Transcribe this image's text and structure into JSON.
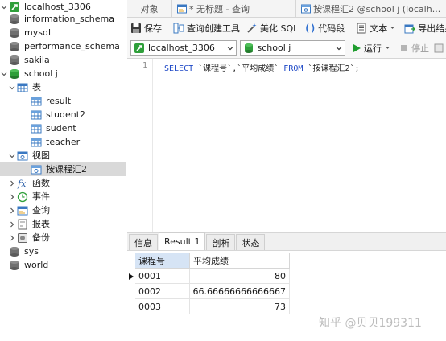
{
  "tree": {
    "items": [
      {
        "label": "localhost_3306",
        "icon": "connection-icon",
        "chevron": "down"
      },
      {
        "label": "information_schema",
        "icon": "database-icon"
      },
      {
        "label": "mysql",
        "icon": "database-icon"
      },
      {
        "label": "performance_schema",
        "icon": "database-icon"
      },
      {
        "label": "sakila",
        "icon": "database-icon"
      },
      {
        "label": "school j",
        "icon": "database-open-icon",
        "chevron": "down"
      },
      {
        "label": "表",
        "icon": "tables-icon",
        "chevron": "down"
      },
      {
        "label": "result",
        "icon": "table-icon"
      },
      {
        "label": "student2",
        "icon": "table-icon"
      },
      {
        "label": "sudent",
        "icon": "table-icon"
      },
      {
        "label": "teacher",
        "icon": "table-icon"
      },
      {
        "label": "视图",
        "icon": "views-icon",
        "chevron": "down"
      },
      {
        "label": "按课程汇2",
        "icon": "view-icon",
        "selected": true
      },
      {
        "label": "函数",
        "icon": "function-icon",
        "chevron": "right"
      },
      {
        "label": "事件",
        "icon": "event-icon",
        "chevron": "right"
      },
      {
        "label": "查询",
        "icon": "query-icon",
        "chevron": "right"
      },
      {
        "label": "报表",
        "icon": "report-icon",
        "chevron": "right"
      },
      {
        "label": "备份",
        "icon": "backup-icon",
        "chevron": "right"
      },
      {
        "label": "sys",
        "icon": "database-icon"
      },
      {
        "label": "world",
        "icon": "database-icon"
      }
    ]
  },
  "tabs": [
    {
      "label": "对象"
    },
    {
      "label": "* 无标题 - 查询",
      "icon": "query-tab-icon"
    },
    {
      "label": "按课程汇2 @school j (localh...",
      "icon": "view-tab-icon"
    }
  ],
  "toolbar": {
    "save": "保存",
    "query_builder": "查询创建工具",
    "beautify": "美化 SQL",
    "snippet": "代码段",
    "text": "文本",
    "export": "导出结果"
  },
  "selectors": {
    "connection": "localhost_3306",
    "database": "school j",
    "run": "运行",
    "stop": "停止"
  },
  "editor": {
    "line_number": "1",
    "kw_select": "SELECT",
    "columns": "`课程号`,`平均成绩`",
    "kw_from": "FROM",
    "table": "`按课程汇2`;"
  },
  "result_tabs": [
    {
      "label": "信息"
    },
    {
      "label": "Result 1",
      "active": true
    },
    {
      "label": "剖析"
    },
    {
      "label": "状态"
    }
  ],
  "grid": {
    "columns": [
      "课程号",
      "平均成绩"
    ],
    "rows": [
      {
        "code": "0001",
        "avg": "80"
      },
      {
        "code": "0002",
        "avg": "66.66666666666667"
      },
      {
        "code": "0003",
        "avg": "73"
      }
    ]
  },
  "watermark": "知乎 @贝贝199311",
  "colors": {
    "connection_green": "#2e9f3a",
    "db_gray": "#6b6b6b",
    "keyword_blue": "#1d48c6",
    "selected_row": "#d9d9d9",
    "header_highlight": "#d6e4f5",
    "run_green": "#1f9d2e"
  }
}
